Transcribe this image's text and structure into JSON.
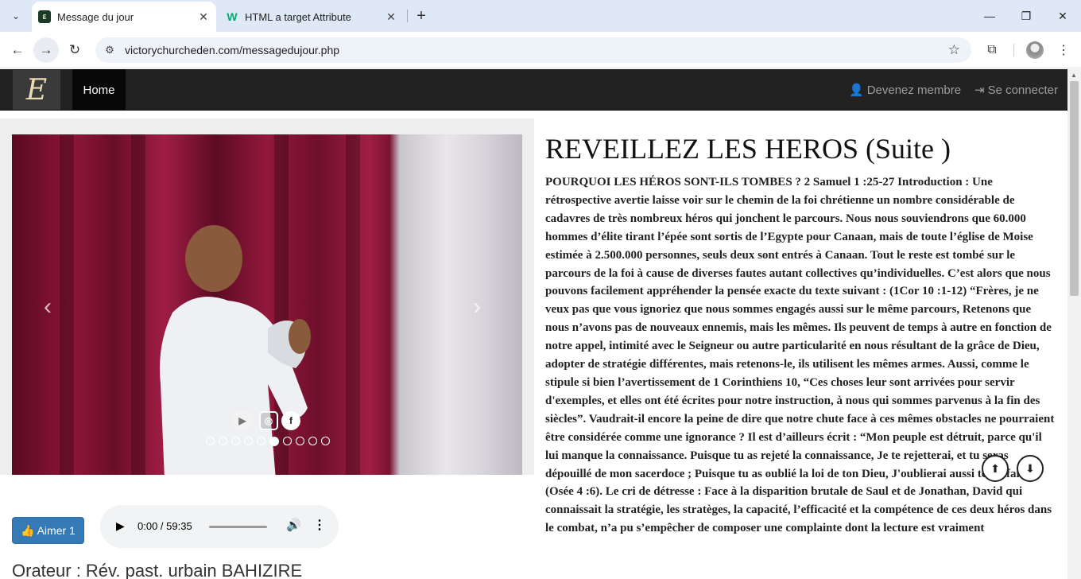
{
  "browser": {
    "tabs": [
      {
        "title": "Message du jour",
        "favicon": "vc-favicon"
      },
      {
        "title": "HTML a target Attribute",
        "favicon": "w3-favicon"
      }
    ],
    "url": "victorychurcheden.com/messagedujour.php"
  },
  "site": {
    "logo_letter": "E",
    "nav": {
      "home": "Home",
      "register": "Devenez membre",
      "login": "Se connecter"
    }
  },
  "player": {
    "like_label": "Aimer 1",
    "time": "0:00 / 59:35"
  },
  "speaker_line": "Orateur : Rév. past. urbain BAHIZIRE",
  "article": {
    "title": "REVEILLEZ LES HEROS (Suite )",
    "text": "POURQUOI LES HÉROS SONT-ILS TOMBES ? 2 Samuel 1 :25-27 Introduction : Une rétrospective avertie laisse voir sur le chemin de la foi chrétienne un nombre considérable de cadavres de très nombreux héros qui jonchent le parcours. Nous nous souviendrons que 60.000 hommes d’élite tirant l’épée sont sortis de l’Egypte pour Canaan, mais de toute l’église de Moise estimée à 2.500.000 personnes, seuls deux sont entrés à Canaan. Tout le reste est tombé sur le parcours de la foi à cause de diverses fautes autant collectives qu’individuelles. C’est alors que nous pouvons facilement appréhender la pensée exacte du texte suivant : (1Cor 10 :1-12) “Frères, je ne veux pas que vous ignoriez que nous sommes engagés aussi sur le même parcours, Retenons que nous n’avons pas de nouveaux ennemis, mais les mêmes. Ils peuvent de temps à autre en fonction de notre appel, intimité avec le Seigneur ou autre particularité en nous résultant de la grâce de Dieu, adopter de stratégie différentes, mais retenons-le, ils utilisent les mêmes armes. Aussi, comme le stipule si bien l’avertissement de 1 Corinthiens 10, “Ces choses leur sont arrivées pour servir d'exemples, et elles ont été écrites pour notre instruction, à nous qui sommes parvenus à la fin des siècles”. Vaudrait-il encore la peine de dire que notre chute face à ces mêmes obstacles ne pourraient être considérée comme une ignorance ? Il est d’ailleurs écrit : “Mon peuple est détruit, parce qu'il lui manque la connaissance. Puisque tu as rejeté la connaissance, Je te rejetterai, et tu seras dépouillé de mon sacerdoce ; Puisque tu as oublié la loi de ton Dieu, J'oublierai aussi tes enfants.” (Osée 4 :6). Le cri de détresse : Face à la disparition brutale de Saul et de Jonathan, David qui connaissait la stratégie, les stratèges, la capacité, l’efficacité et la compétence de ces deux héros dans le combat, n’a pu s’empêcher de composer une complainte dont la lecture est vraiment"
  }
}
